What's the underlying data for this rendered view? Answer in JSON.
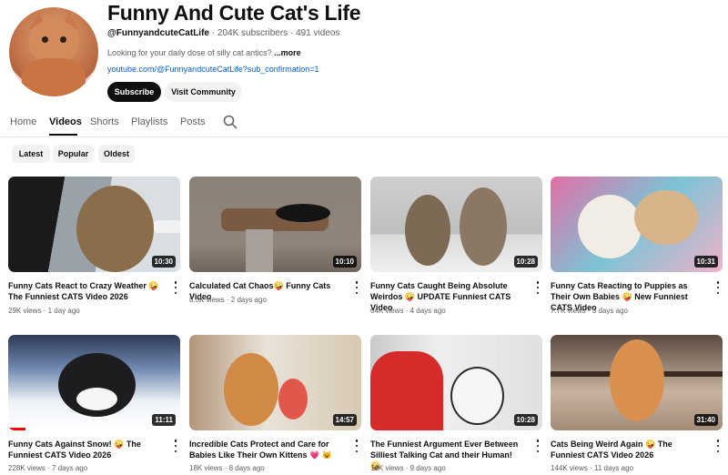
{
  "channel": {
    "title": "Funny And Cute Cat's Life",
    "handle": "@FunnyandcuteCatLife",
    "subscribers": "204K subscribers",
    "videos_count": "491 videos",
    "description": "Looking for your daily dose of silly cat antics?",
    "more": "...more",
    "link": "youtube.com/@FunnyandcuteCatLife?sub_confirmation=1",
    "subscribe_label": "Subscribe",
    "community_label": "Visit Community",
    "meta_sep": "·"
  },
  "tabs": [
    "Home",
    "Videos",
    "Shorts",
    "Playlists",
    "Posts"
  ],
  "active_tab": "Videos",
  "chips": [
    "Latest",
    "Popular",
    "Oldest"
  ],
  "videos": [
    {
      "title": "Funny Cats React to Crazy Weather 🤪 The Funniest CATS Video 2026",
      "views": "29K views",
      "age": "1 day ago",
      "duration": "10:30"
    },
    {
      "title": "Calculated Cat Chaos🤪 Funny Cats Video",
      "views": "8.5K views",
      "age": "2 days ago",
      "duration": "10:10"
    },
    {
      "title": "Funny Cats Caught Being Absolute Weirdos 🤪 UPDATE Funniest CATS Video",
      "views": "64K views",
      "age": "4 days ago",
      "duration": "10:28"
    },
    {
      "title": "Funny Cats Reacting to Puppies as Their Own Babies 🤪 New Funniest CATS Video",
      "views": "7.7K views",
      "age": "5 days ago",
      "duration": "10:31"
    },
    {
      "title": "Funny Cats Against Snow! 🤪 The Funniest CATS Video 2026",
      "views": "228K views",
      "age": "7 days ago",
      "duration": "11:11"
    },
    {
      "title": "Incredible Cats Protect and Care for Babies Like Their Own Kittens 💗 😺",
      "views": "18K views",
      "age": "8 days ago",
      "duration": "14:57"
    },
    {
      "title": "The Funniest Argument Ever Between Silliest Talking Cat and their Human! 🤪",
      "views": "16K views",
      "age": "9 days ago",
      "duration": "10:28"
    },
    {
      "title": "Cats Being Weird Again 🤪 The Funniest CATS Video 2026",
      "views": "144K views",
      "age": "11 days ago",
      "duration": "31:40"
    }
  ],
  "watch_progress": {
    "video_5": 0.1
  },
  "colors": {
    "accent": "#0f0f0f",
    "link": "#065fd4",
    "progress": "#ff0000"
  },
  "icons": {
    "search": "search-icon",
    "menu": "more-vert-icon"
  }
}
